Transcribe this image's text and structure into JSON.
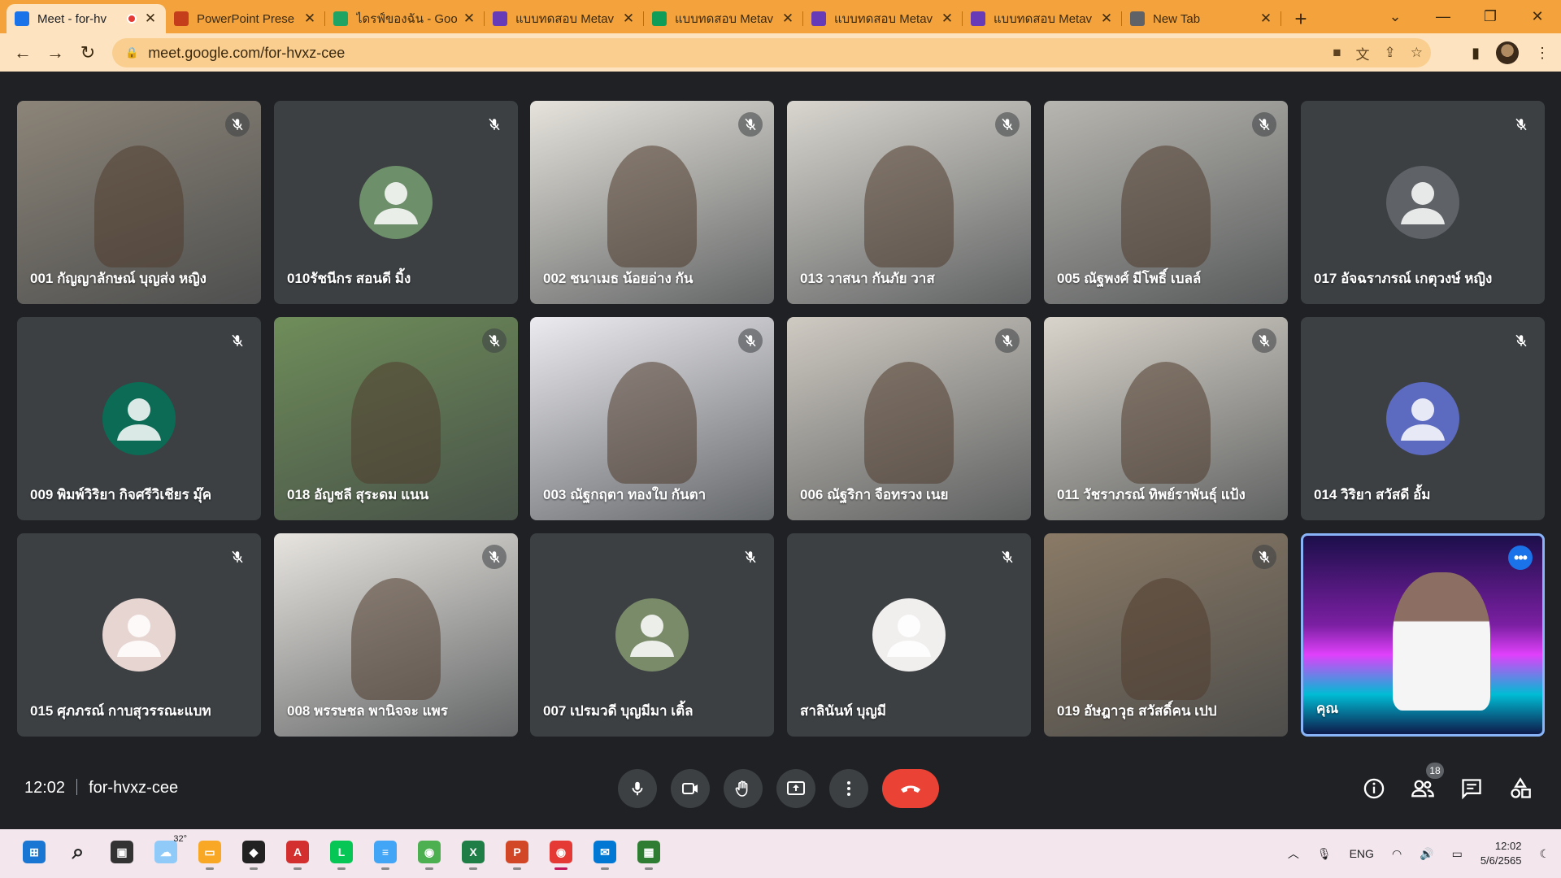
{
  "browser": {
    "tabs": [
      {
        "title": "Meet - for-hv",
        "favicon": "meet-icon",
        "color": "#1a73e8",
        "active": true,
        "recording": true
      },
      {
        "title": "PowerPoint Prese",
        "favicon": "powerpoint-icon",
        "color": "#c43e1c"
      },
      {
        "title": "ไดรฟ์ของฉัน - Goo",
        "favicon": "drive-icon",
        "color": "#1fa463"
      },
      {
        "title": "แบบทดสอบ Metav",
        "favicon": "forms-icon",
        "color": "#673ab7"
      },
      {
        "title": "แบบทดสอบ Metav",
        "favicon": "sheets-icon",
        "color": "#0f9d58"
      },
      {
        "title": "แบบทดสอบ Metav",
        "favicon": "forms-icon",
        "color": "#673ab7"
      },
      {
        "title": "แบบทดสอบ Metav",
        "favicon": "forms-icon",
        "color": "#673ab7"
      },
      {
        "title": "New Tab",
        "favicon": "chrome-icon",
        "color": "#5f6368"
      }
    ],
    "url": "meet.google.com/for-hvxz-cee"
  },
  "participants": [
    {
      "name": "001 กัญญาลักษณ์ บุญส่ง หญิง",
      "type": "video",
      "bg": "#8c8478",
      "muted": true
    },
    {
      "name": "010รัชนีกร สอนดี มิ้ง",
      "type": "avatar",
      "avatar_color": "#6d8f6a",
      "muted": true
    },
    {
      "name": "002 ชนาเมธ น้อยอ่าง กัน",
      "type": "video",
      "bg": "#e6e3dc",
      "muted": true
    },
    {
      "name": "013 วาสนา กันภัย วาส",
      "type": "video",
      "bg": "#d9d6cf",
      "muted": true
    },
    {
      "name": "005 ณัฐพงศ์ มีโพธิ์ เบลล์",
      "type": "video",
      "bg": "#b8b6b0",
      "muted": true
    },
    {
      "name": "017 อัจฉราภรณ์ เกตุวงษ์ หญิง",
      "type": "avatar",
      "avatar_color": "#5f6368",
      "muted": true
    },
    {
      "name": "009 พิมพ์วิริยา กิจศรีวิเชียร มุ๊ค",
      "type": "avatar",
      "avatar_color": "#0b6b55",
      "muted": true
    },
    {
      "name": "018 อัญชลี สุระดม แนน",
      "type": "video",
      "bg": "#6f8d5a",
      "muted": true
    },
    {
      "name": "003 ณัฐกฤตา ทองใบ กันตา",
      "type": "video",
      "bg": "#ecebf0",
      "muted": true
    },
    {
      "name": "006 ณัฐริกา จือทรวง เนย",
      "type": "video",
      "bg": "#cfcac2",
      "muted": true
    },
    {
      "name": "011 วัชราภรณ์ ทิพย์ราพันธุ์ แป้ง",
      "type": "video",
      "bg": "#d9d4cb",
      "muted": true
    },
    {
      "name": "014 วิริยา สวัสดี อั้ม",
      "type": "avatar",
      "avatar_color": "#5c6bc0",
      "muted": true
    },
    {
      "name": "015 ศุภภรณ์ กาบสุวรรณะแบท",
      "type": "avatar",
      "avatar_color": "#e7d5d2",
      "muted": true
    },
    {
      "name": "008 พรรษชล พานิจจะ แพร",
      "type": "video",
      "bg": "#e8e5e0",
      "muted": true
    },
    {
      "name": "007 เปรมวดี บุญมีมา เติ้ล",
      "type": "avatar",
      "avatar_color": "#7a8b6a",
      "muted": true
    },
    {
      "name": "สาลินันท์ บุญมี",
      "type": "avatar",
      "avatar_color": "#f1eeee",
      "muted": true
    },
    {
      "name": "019 อัษฎาวุธ สวัสดิ์คน เปป",
      "type": "video",
      "bg": "#8a7a66",
      "muted": true
    },
    {
      "name": "คุณ",
      "type": "video",
      "bg": "#3a1f6b",
      "self": true,
      "muted": false
    }
  ],
  "meeting": {
    "time": "12:02",
    "code": "for-hvxz-cee",
    "people_count": "18"
  },
  "taskbar": {
    "weather": "32°",
    "lang": "ENG",
    "time": "12:02",
    "date": "5/6/2565",
    "apps": [
      "windows-start-icon",
      "search-icon",
      "task-view-icon",
      "weather-icon",
      "file-explorer-icon",
      "predator-icon",
      "acrobat-icon",
      "line-icon",
      "notepad-icon",
      "chrome-profile-icon",
      "excel-icon",
      "powerpoint-icon",
      "chrome-icon",
      "mail-icon",
      "network-app-icon"
    ]
  },
  "colors": {
    "tab_strip": "#f4a33c",
    "toolbar": "#fde3bf",
    "meet_bg": "#202124",
    "end_call": "#ea4335",
    "self_border": "#8ab4f8"
  }
}
